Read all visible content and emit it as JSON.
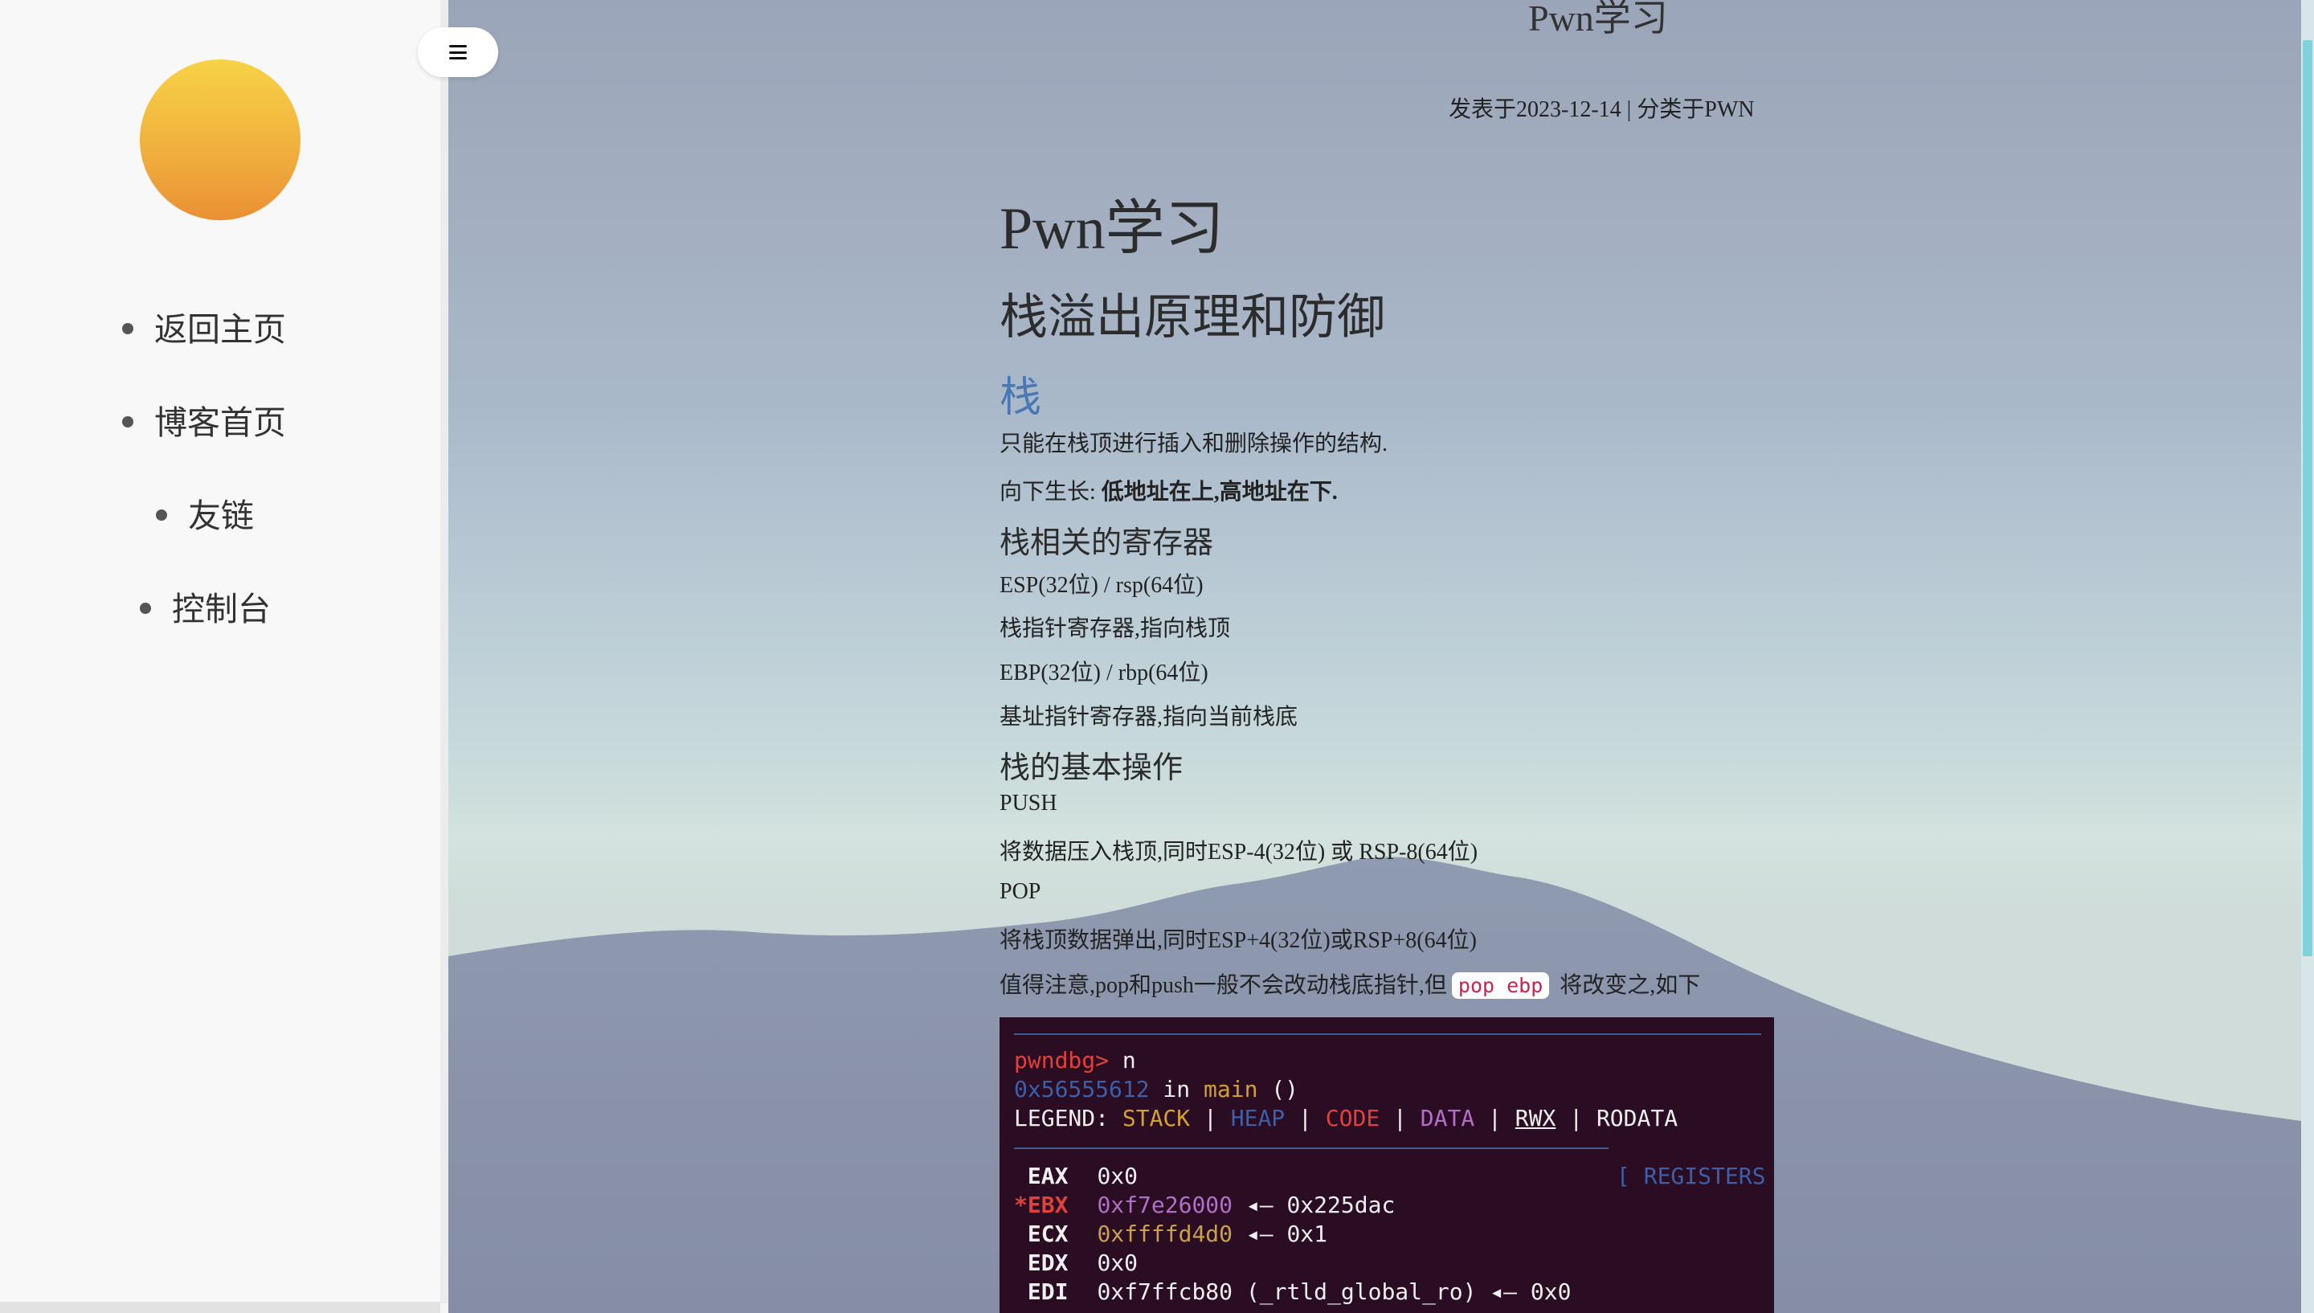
{
  "sidebar": {
    "nav": [
      {
        "label": "返回主页"
      },
      {
        "label": "博客首页"
      },
      {
        "label": "友链"
      },
      {
        "label": "控制台"
      }
    ]
  },
  "post": {
    "header_title": "Pwn学习",
    "meta": "发表于2023-12-14 | 分类于PWN",
    "h1": "Pwn学习",
    "h2": "栈溢出原理和防御",
    "h3": "栈",
    "p1": "只能在栈顶进行插入和删除操作的结构.",
    "p2_prefix": "向下生长: ",
    "p2_bold": "低地址在上,高地址在下.",
    "h4_registers": "栈相关的寄存器",
    "esp": "ESP(32位) / rsp(64位)",
    "esp_desc": "栈指针寄存器,指向栈顶",
    "ebp": "EBP(32位) / rbp(64位)",
    "ebp_desc": "基址指针寄存器,指向当前栈底",
    "h4_ops": "栈的基本操作",
    "push": "PUSH",
    "push_desc": "将数据压入栈顶,同时ESP-4(32位) 或 RSP-8(64位)",
    "pop": "POP",
    "pop_desc": "将栈顶数据弹出,同时ESP+4(32位)或RSP+8(64位)",
    "note_prefix": "值得注意,pop和push一般不会改动栈底指针,但",
    "note_code": "pop ebp",
    "note_suffix": " 将改变之,如下"
  },
  "terminal": {
    "prompt": "pwndbg>",
    "cmd": " n",
    "addr": "0x56555612",
    "in_main": " in ",
    "main": "main",
    "main_args": " ()",
    "legend_label": "LEGEND: ",
    "legend_stack": "STACK",
    "legend_heap": "HEAP",
    "legend_code": "CODE",
    "legend_data": "DATA",
    "legend_rwx": "RWX",
    "legend_rodata": "RODATA",
    "sep": " | ",
    "registers_header": "[ REGISTERS",
    "regs": [
      {
        "name": " EAX",
        "value": "0x0",
        "ptr": ""
      },
      {
        "name": "*EBX",
        "value": "0xf7e26000",
        "ptr": " ◂— 0x225dac"
      },
      {
        "name": " ECX",
        "value": "0xffffd4d0",
        "ptr": " ◂— 0x1"
      },
      {
        "name": " EDX",
        "value": "0x0",
        "ptr": ""
      },
      {
        "name": " EDI",
        "value": "0xf7ffcb80 (_rtld_global_ro)",
        "ptr": " ◂— 0x0"
      }
    ]
  },
  "colors": {
    "heading_link": "#4a78b4",
    "terminal_bg": "#2a0d22",
    "avatar_top": "#f7d246",
    "avatar_bottom": "#e99035"
  }
}
